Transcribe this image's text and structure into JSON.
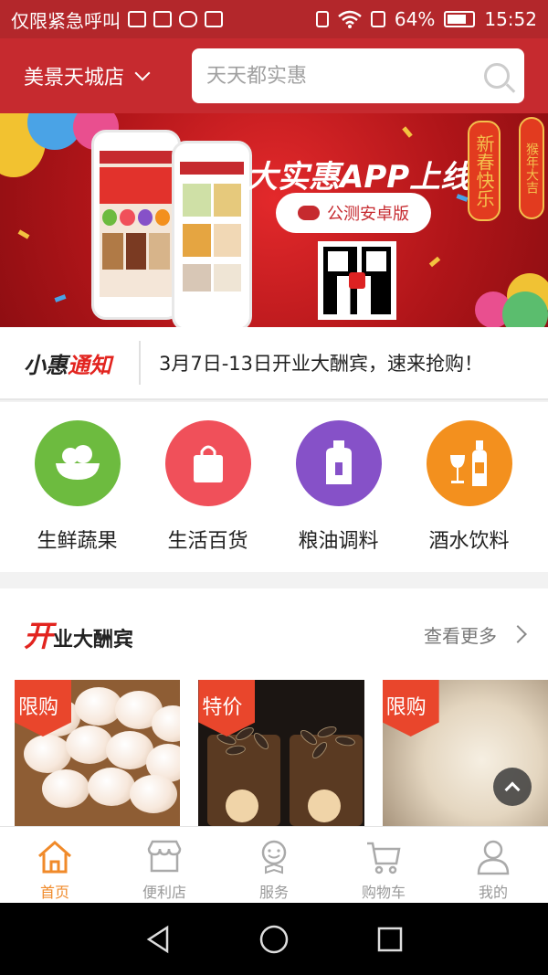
{
  "status_bar": {
    "carrier": "仅限紧急呼叫",
    "battery": "64%",
    "time": "15:52"
  },
  "header": {
    "store_name": "美景天城店",
    "search_placeholder": "天天都实惠"
  },
  "banner": {
    "title": "大实惠APP上线",
    "button_label": "公测安卓版",
    "lantern_left": "新春快乐",
    "lantern_right": "猴年大吉"
  },
  "notice": {
    "logo_black": "小惠",
    "logo_red": "通知",
    "text": "3月7日-13日开业大酬宾，速来抢购！"
  },
  "categories": [
    {
      "label": "生鲜蔬果",
      "icon": "fruit-bowl-icon",
      "color": "#6dbb3f"
    },
    {
      "label": "生活百货",
      "icon": "shopping-bag-icon",
      "color": "#f0505a"
    },
    {
      "label": "粮油调料",
      "icon": "oil-bottle-icon",
      "color": "#8651c8"
    },
    {
      "label": "酒水饮料",
      "icon": "wine-icon",
      "color": "#f3901e"
    }
  ],
  "section": {
    "title_first": "开",
    "title_rest": "业大酬宾",
    "more_label": "查看更多",
    "products": [
      {
        "tag": "限购",
        "image": "eggs"
      },
      {
        "tag": "特价",
        "image": "sunflower-seeds"
      },
      {
        "tag": "限购",
        "image": "rice"
      }
    ]
  },
  "tabbar": {
    "items": [
      {
        "label": "首页",
        "icon": "home-icon",
        "active": true
      },
      {
        "label": "便利店",
        "icon": "store-icon",
        "active": false
      },
      {
        "label": "服务",
        "icon": "service-icon",
        "active": false
      },
      {
        "label": "购物车",
        "icon": "cart-icon",
        "active": false
      },
      {
        "label": "我的",
        "icon": "user-icon",
        "active": false
      }
    ]
  },
  "colors": {
    "brand_red": "#c62a2f",
    "active_orange": "#f08a2a",
    "tag_red": "#e9462c"
  }
}
